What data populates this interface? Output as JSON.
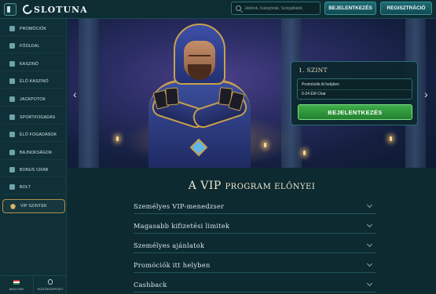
{
  "header": {
    "logo_text": "SLOTUNA",
    "search_placeholder": "Játékok, Kategóriák, Szolgáltatók",
    "login_label": "BEJELENTKEZÉS",
    "register_label": "REGISZTRÁCIÓ"
  },
  "sidebar": {
    "items": [
      {
        "label": "PROMÓCIÓK",
        "icon": "gift-icon"
      },
      {
        "label": "FŐOLDAL",
        "icon": "home-icon"
      },
      {
        "label": "KASZINÓ",
        "icon": "slot-machine-icon"
      },
      {
        "label": "ÉLŐ KASZINÓ",
        "icon": "live-dealer-icon"
      },
      {
        "label": "JACKPOTOK",
        "icon": "jackpot-icon"
      },
      {
        "label": "SPORTFOGADÁS",
        "icon": "soccer-ball-icon"
      },
      {
        "label": "ÉLŐ FOGADÁSOK",
        "icon": "live-betting-icon"
      },
      {
        "label": "BAJNOKSÁGOK",
        "icon": "trophy-icon"
      },
      {
        "label": "BONUS CRAB",
        "icon": "crab-icon"
      },
      {
        "label": "BOLT",
        "icon": "shop-icon"
      },
      {
        "label": "VIP SZINTEK",
        "icon": "diamond-icon",
        "active": true
      }
    ],
    "language_label": "MAGYAR",
    "help_label": "SÚGÓKÖZPONT"
  },
  "banner": {
    "level_title": "1. SZINT",
    "perks": [
      "Promóciók itt helyben",
      "0-24 Élő Chat"
    ],
    "login_button": "BEJELENTKEZÉS"
  },
  "vip": {
    "title_main": "A VIP",
    "title_rest": "program előnyei",
    "benefits": [
      "Személyes VIP-menedzser",
      "Magasabb kifizetési limitek",
      "Személyes ajánlatok",
      "Promóciók itt helyben",
      "Cashback"
    ]
  },
  "colors": {
    "background": "#0c2a30",
    "accent_gold": "#c7a04e",
    "cta_green": "#3fae4a"
  }
}
